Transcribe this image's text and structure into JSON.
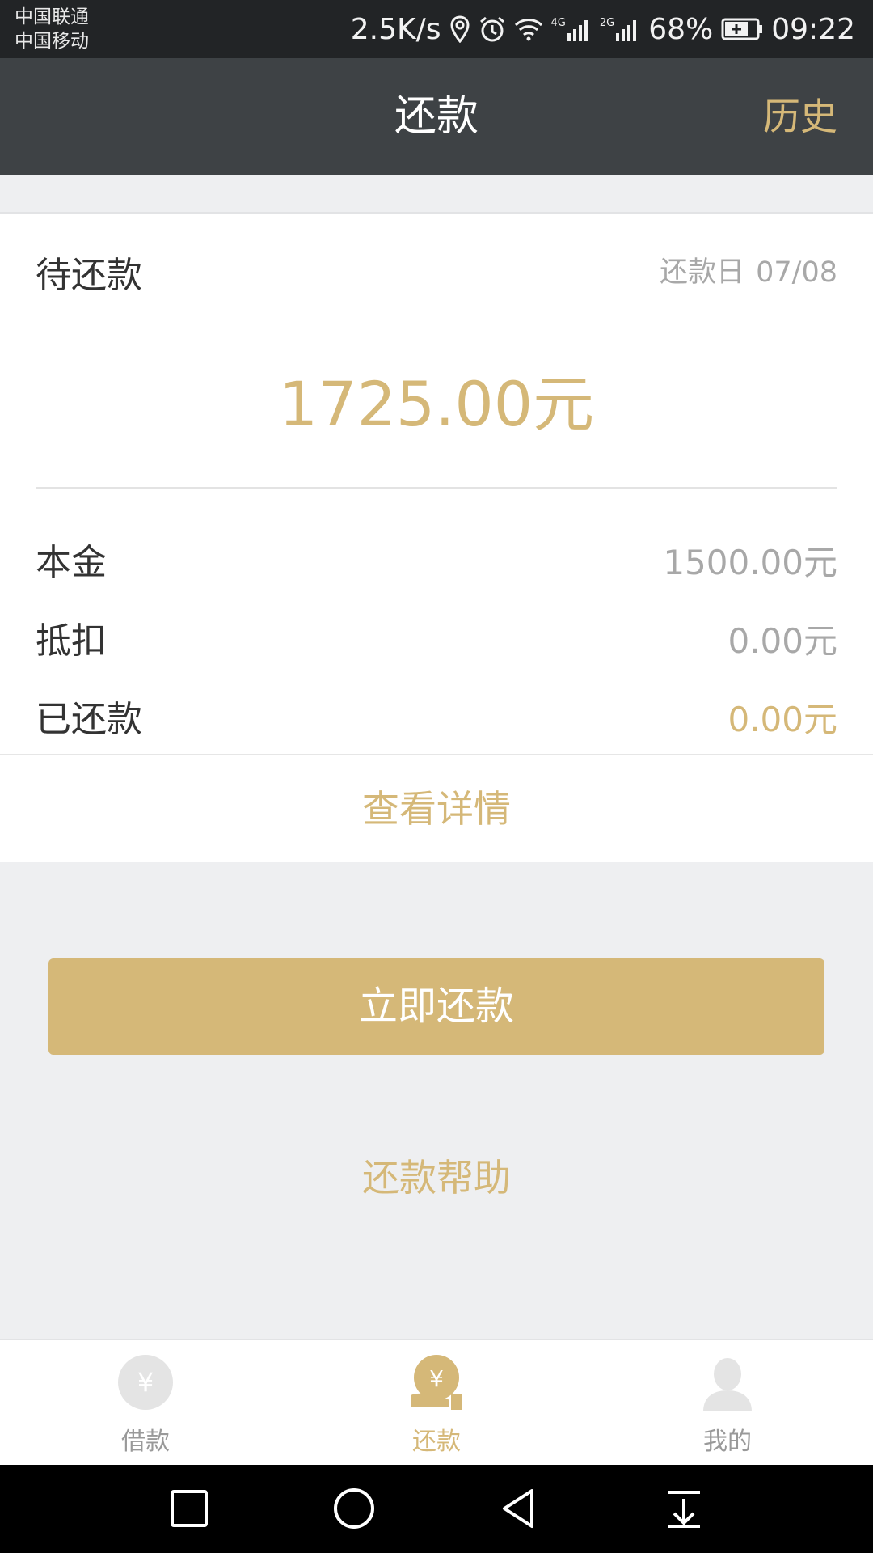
{
  "status_bar": {
    "carrier_1": "中国联通",
    "carrier_2": "中国移动",
    "speed": "2.5K/s",
    "net_1": "4G",
    "net_2": "2G",
    "battery": "68%",
    "time": "09:22"
  },
  "header": {
    "title": "还款",
    "history_label": "历史"
  },
  "repayment": {
    "pending_label": "待还款",
    "due_label": "还款日",
    "due_date": "07/08",
    "amount": "1725.00元",
    "rows": [
      {
        "label": "本金",
        "value": "1500.00元"
      },
      {
        "label": "抵扣",
        "value": "0.00元"
      },
      {
        "label": "已还款",
        "value": "0.00元"
      }
    ],
    "details_link": "查看详情"
  },
  "actions": {
    "repay_now": "立即还款",
    "help": "还款帮助"
  },
  "tabs": [
    {
      "label": "借款",
      "icon": "yen-coin-icon"
    },
    {
      "label": "还款",
      "icon": "yen-hand-icon"
    },
    {
      "label": "我的",
      "icon": "user-icon"
    }
  ],
  "colors": {
    "accent": "#d5b878",
    "nav_bg": "#3e4245",
    "page_bg": "#eeeff1"
  }
}
